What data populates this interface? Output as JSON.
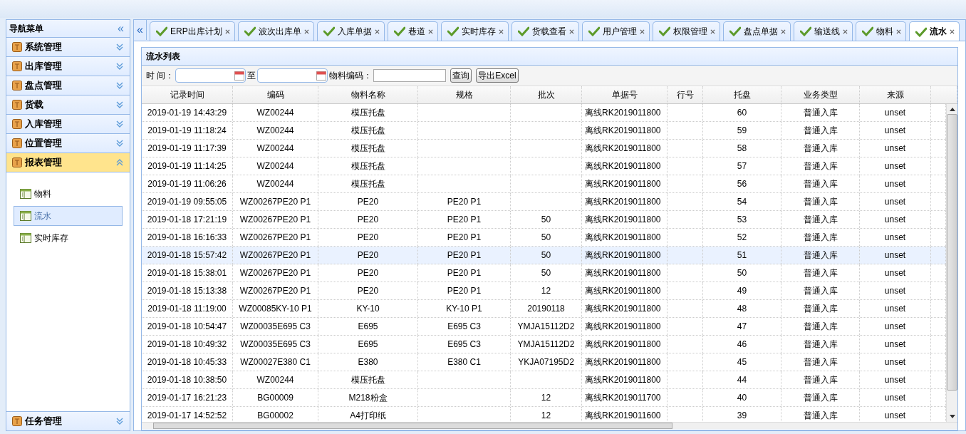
{
  "sidebar": {
    "title": "导航菜单",
    "collapse_icon": "«",
    "sections": [
      {
        "label": "系统管理",
        "expanded": false
      },
      {
        "label": "出库管理",
        "expanded": false
      },
      {
        "label": "盘点管理",
        "expanded": false
      },
      {
        "label": "货载",
        "expanded": false
      },
      {
        "label": "入库管理",
        "expanded": false
      },
      {
        "label": "位置管理",
        "expanded": false
      },
      {
        "label": "报表管理",
        "expanded": true,
        "items": [
          {
            "label": "物料",
            "selected": false
          },
          {
            "label": "流水",
            "selected": true
          },
          {
            "label": "实时库存",
            "selected": false
          }
        ]
      },
      {
        "label": "任务管理",
        "expanded": false
      }
    ]
  },
  "tab_scroll_icon": "«",
  "tabs": [
    {
      "label": "ERP出库计划",
      "selected": false
    },
    {
      "label": "波次出库单",
      "selected": false
    },
    {
      "label": "入库单据",
      "selected": false
    },
    {
      "label": "巷道",
      "selected": false
    },
    {
      "label": "实时库存",
      "selected": false
    },
    {
      "label": "货载查看",
      "selected": false
    },
    {
      "label": "用户管理",
      "selected": false
    },
    {
      "label": "权限管理",
      "selected": false
    },
    {
      "label": "盘点单据",
      "selected": false
    },
    {
      "label": "输送线",
      "selected": false
    },
    {
      "label": "物料",
      "selected": false
    },
    {
      "label": "流水",
      "selected": true
    }
  ],
  "panel": {
    "title": "流水列表",
    "filters": {
      "time_label": "时 间：",
      "to_label": "至",
      "code_label": "物料编码：",
      "query_button": "查询",
      "export_button": "导出Excel"
    },
    "table": {
      "columns": [
        "记录时间",
        "编码",
        "物料名称",
        "规格",
        "批次",
        "单据号",
        "行号",
        "托盘",
        "业务类型",
        "来源"
      ],
      "rows": [
        {
          "cells": [
            "2019-01-19 14:43:29",
            "WZ00244",
            "模压托盘",
            "",
            "",
            "离线RK2019011800",
            "",
            "60",
            "普通入库",
            "unset"
          ],
          "selected": false
        },
        {
          "cells": [
            "2019-01-19 11:18:24",
            "WZ00244",
            "模压托盘",
            "",
            "",
            "离线RK2019011800",
            "",
            "59",
            "普通入库",
            "unset"
          ],
          "selected": false
        },
        {
          "cells": [
            "2019-01-19 11:17:39",
            "WZ00244",
            "模压托盘",
            "",
            "",
            "离线RK2019011800",
            "",
            "58",
            "普通入库",
            "unset"
          ],
          "selected": false
        },
        {
          "cells": [
            "2019-01-19 11:14:25",
            "WZ00244",
            "模压托盘",
            "",
            "",
            "离线RK2019011800",
            "",
            "57",
            "普通入库",
            "unset"
          ],
          "selected": false
        },
        {
          "cells": [
            "2019-01-19 11:06:26",
            "WZ00244",
            "模压托盘",
            "",
            "",
            "离线RK2019011800",
            "",
            "56",
            "普通入库",
            "unset"
          ],
          "selected": false
        },
        {
          "cells": [
            "2019-01-19 09:55:05",
            "WZ00267PE20 P1",
            "PE20",
            "PE20 P1",
            "",
            "离线RK2019011800",
            "",
            "54",
            "普通入库",
            "unset"
          ],
          "selected": false
        },
        {
          "cells": [
            "2019-01-18 17:21:19",
            "WZ00267PE20 P1",
            "PE20",
            "PE20 P1",
            "50",
            "离线RK2019011800",
            "",
            "53",
            "普通入库",
            "unset"
          ],
          "selected": false
        },
        {
          "cells": [
            "2019-01-18 16:16:33",
            "WZ00267PE20 P1",
            "PE20",
            "PE20 P1",
            "50",
            "离线RK2019011800",
            "",
            "52",
            "普通入库",
            "unset"
          ],
          "selected": false
        },
        {
          "cells": [
            "2019-01-18 15:57:42",
            "WZ00267PE20 P1",
            "PE20",
            "PE20 P1",
            "50",
            "离线RK2019011800",
            "",
            "51",
            "普通入库",
            "unset"
          ],
          "selected": true
        },
        {
          "cells": [
            "2019-01-18 15:38:01",
            "WZ00267PE20 P1",
            "PE20",
            "PE20 P1",
            "50",
            "离线RK2019011800",
            "",
            "50",
            "普通入库",
            "unset"
          ],
          "selected": false
        },
        {
          "cells": [
            "2019-01-18 15:13:38",
            "WZ00267PE20 P1",
            "PE20",
            "PE20 P1",
            "12",
            "离线RK2019011800",
            "",
            "49",
            "普通入库",
            "unset"
          ],
          "selected": false
        },
        {
          "cells": [
            "2019-01-18 11:19:00",
            "WZ00085KY-10 P1",
            "KY-10",
            "KY-10 P1",
            "20190118",
            "离线RK2019011800",
            "",
            "48",
            "普通入库",
            "unset"
          ],
          "selected": false
        },
        {
          "cells": [
            "2019-01-18 10:54:47",
            "WZ00035E695 C3",
            "E695",
            "E695 C3",
            "YMJA15112D2",
            "离线RK2019011800",
            "",
            "47",
            "普通入库",
            "unset"
          ],
          "selected": false
        },
        {
          "cells": [
            "2019-01-18 10:49:32",
            "WZ00035E695 C3",
            "E695",
            "E695 C3",
            "YMJA15112D2",
            "离线RK2019011800",
            "",
            "46",
            "普通入库",
            "unset"
          ],
          "selected": false
        },
        {
          "cells": [
            "2019-01-18 10:45:33",
            "WZ00027E380 C1",
            "E380",
            "E380 C1",
            "YKJA07195D2",
            "离线RK2019011800",
            "",
            "45",
            "普通入库",
            "unset"
          ],
          "selected": false
        },
        {
          "cells": [
            "2019-01-18 10:38:50",
            "WZ00244",
            "模压托盘",
            "",
            "",
            "离线RK2019011800",
            "",
            "44",
            "普通入库",
            "unset"
          ],
          "selected": false
        },
        {
          "cells": [
            "2019-01-17 16:21:23",
            "BG00009",
            "M218粉盒",
            "",
            "12",
            "离线RK2019011700",
            "",
            "40",
            "普通入库",
            "unset"
          ],
          "selected": false
        },
        {
          "cells": [
            "2019-01-17 14:52:52",
            "BG00002",
            "A4打印纸",
            "",
            "12",
            "离线RK2019011600",
            "",
            "39",
            "普通入库",
            "unset"
          ],
          "selected": false
        }
      ]
    }
  }
}
